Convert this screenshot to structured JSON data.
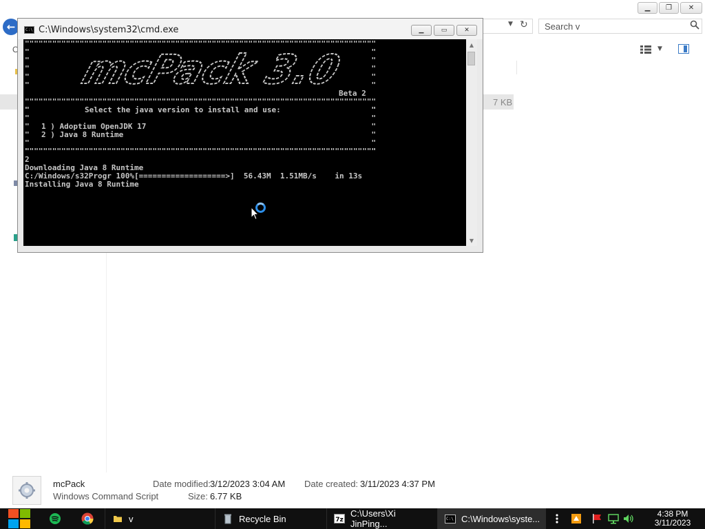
{
  "explorer": {
    "search_placeholder": "Search v",
    "org_label": "O",
    "file_size_partial": "7 KB",
    "details": {
      "name": "mcPack",
      "type": "Windows Command Script",
      "modified_label": "Date modified:",
      "modified_value": "3/12/2023 3:04 AM",
      "size_label": "Size:",
      "size_value": "6.77 KB",
      "created_label": "Date created:",
      "created_value": "3/11/2023 4:37 PM"
    }
  },
  "cmd": {
    "title": "C:\\Windows\\system32\\cmd.exe",
    "logo_text": "mcPack 3.0",
    "beta": "Beta 2",
    "prompt": "Select the java version to install and use:",
    "option1": "1 ) Adoptium OpenJDK 17",
    "option2": "2 ) Java 8 Runtime",
    "input": "2",
    "downloading": "Downloading Java 8 Runtime",
    "progress_line": "C:/Windows/s32Progr 100%[===================>]  56.43M  1.51MB/s    in 13s",
    "installing": "Installing Java 8 Runtime"
  },
  "taskbar": {
    "items": [
      {
        "label": "v",
        "icon": "folder-icon"
      },
      {
        "label": "Recycle Bin",
        "icon": "recycle-bin-icon"
      },
      {
        "label": "C:\\Users\\Xi JinPing...",
        "icon": "7zip-icon"
      },
      {
        "label": "C:\\Windows\\syste...",
        "icon": "cmd-icon"
      }
    ],
    "time": "4:38 PM",
    "date": "3/11/2023"
  },
  "colors": {
    "accent": "#2d6cc6",
    "console_bg": "#000000",
    "console_fg": "#c7c7c7",
    "taskbar": "#101010"
  }
}
